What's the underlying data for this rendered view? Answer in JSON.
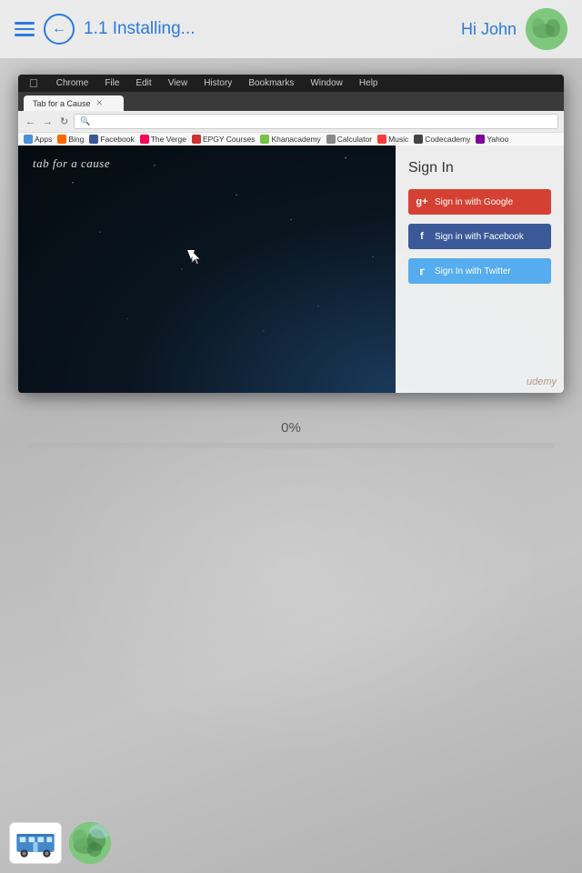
{
  "topbar": {
    "title": "1.1 Installing...",
    "greeting": "Hi John"
  },
  "browser": {
    "tab_title": "Tab for a Cause",
    "menubar_items": [
      "Chrome",
      "File",
      "Edit",
      "View",
      "History",
      "Bookmarks",
      "Window",
      "Help"
    ],
    "bookmarks": [
      "Apps",
      "Bing",
      "Facebook",
      "The Verge",
      "EPGY Courses",
      "Khanacademy",
      "Calculator",
      "Music",
      "Codecademy",
      "Yahoo"
    ],
    "page_label": "tab for a cause",
    "signin": {
      "title": "Sign In",
      "google_btn": "Sign in with Google",
      "facebook_btn": "Sign in with Facebook",
      "twitter_btn": "Sign In with Twitter",
      "watermark": "udemy"
    }
  },
  "progress": {
    "percent": "0%",
    "value": 0
  }
}
